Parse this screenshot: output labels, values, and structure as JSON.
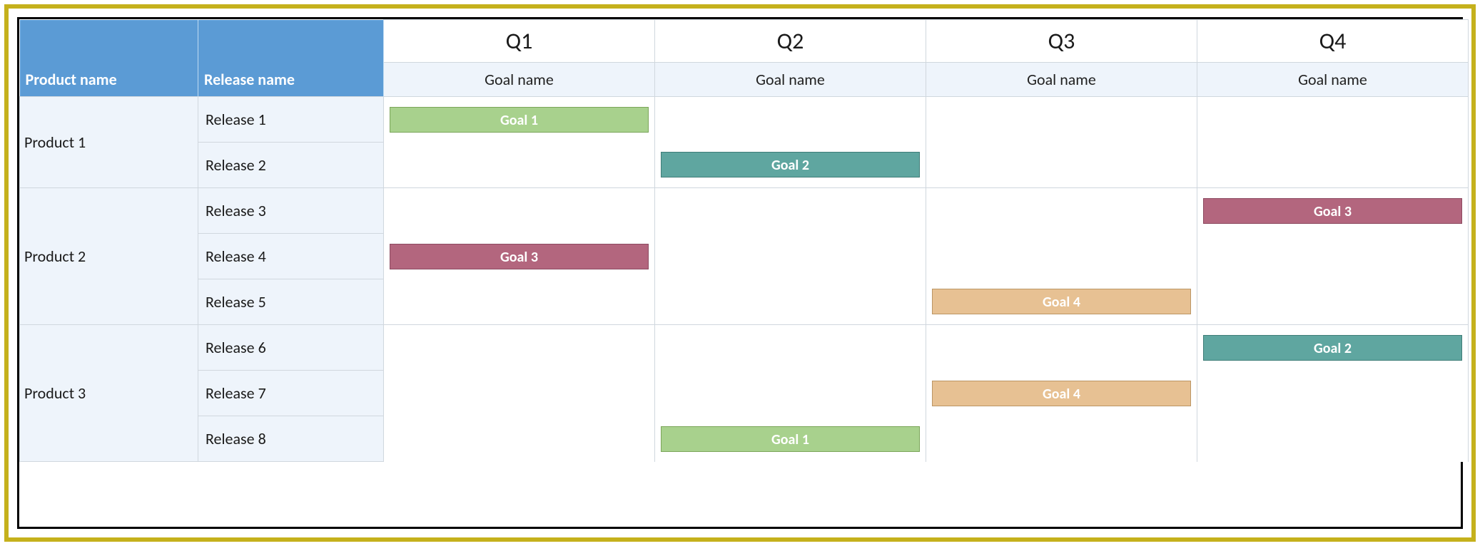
{
  "headers": {
    "product_col": "Product name",
    "release_col": "Release name",
    "quarters": [
      "Q1",
      "Q2",
      "Q3",
      "Q4"
    ],
    "goal_sub": [
      "Goal name",
      "Goal name",
      "Goal name",
      "Goal name"
    ]
  },
  "colors": {
    "green": "#a8d18d",
    "teal": "#5fa6a0",
    "rose": "#b3667e",
    "tan": "#e7c193",
    "header_blue": "#5b9bd5",
    "row_bg": "#eef4fb"
  },
  "products": [
    {
      "name": "Product 1",
      "releases": [
        {
          "name": "Release 1",
          "goals": {
            "q1": {
              "label": "Goal 1",
              "color": "green"
            }
          }
        },
        {
          "name": "Release 2",
          "goals": {
            "q2": {
              "label": "Goal 2",
              "color": "teal"
            }
          }
        }
      ]
    },
    {
      "name": "Product 2",
      "releases": [
        {
          "name": "Release 3",
          "goals": {
            "q4": {
              "label": "Goal 3",
              "color": "rose"
            }
          }
        },
        {
          "name": "Release 4",
          "goals": {
            "q1": {
              "label": "Goal 3",
              "color": "rose"
            }
          }
        },
        {
          "name": "Release 5",
          "goals": {
            "q3": {
              "label": "Goal 4",
              "color": "tan"
            }
          }
        }
      ]
    },
    {
      "name": "Product 3",
      "releases": [
        {
          "name": "Release 6",
          "goals": {
            "q4": {
              "label": "Goal 2",
              "color": "teal"
            }
          }
        },
        {
          "name": "Release 7",
          "goals": {
            "q3": {
              "label": "Goal 4",
              "color": "tan"
            }
          }
        },
        {
          "name": "Release 8",
          "goals": {
            "q2": {
              "label": "Goal 1",
              "color": "green"
            }
          }
        }
      ]
    }
  ]
}
